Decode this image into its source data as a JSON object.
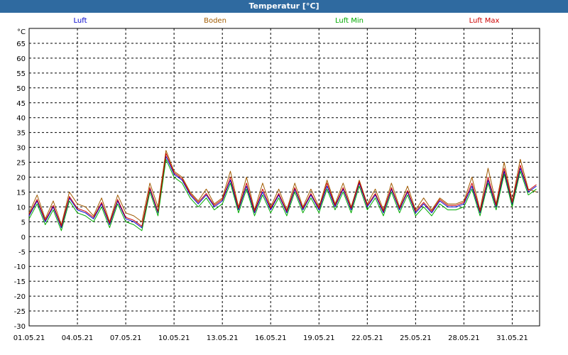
{
  "window": {
    "title": "Temperatur [°C]"
  },
  "chart_data": {
    "type": "line",
    "title": "Temperatur [°C]",
    "ylabel": "°C",
    "xlabel": "",
    "ylim": [
      -30,
      70
    ],
    "yticks": [
      65,
      60,
      55,
      50,
      45,
      40,
      35,
      30,
      25,
      20,
      15,
      10,
      5,
      0,
      -5,
      -10,
      -15,
      -20,
      -25,
      -30
    ],
    "xlim": [
      0,
      31.7
    ],
    "xticks": [
      "01.05.21",
      "04.05.21",
      "07.05.21",
      "10.05.21",
      "13.05.21",
      "16.05.21",
      "19.05.21",
      "22.05.21",
      "25.05.21",
      "28.05.21",
      "31.05.21"
    ],
    "xtick_days": [
      0,
      3,
      6,
      9,
      12,
      15,
      18,
      21,
      24,
      27,
      30
    ],
    "grid": true,
    "legend_position": "top",
    "x_unit": "days since 01.05.21",
    "x": [
      0.0,
      0.5,
      1.0,
      1.5,
      2.0,
      2.5,
      3.0,
      3.5,
      4.0,
      4.5,
      5.0,
      5.5,
      6.0,
      6.5,
      7.0,
      7.5,
      8.0,
      8.5,
      9.0,
      9.5,
      10.0,
      10.5,
      11.0,
      11.5,
      12.0,
      12.5,
      13.0,
      13.5,
      14.0,
      14.5,
      15.0,
      15.5,
      16.0,
      16.5,
      17.0,
      17.5,
      18.0,
      18.5,
      19.0,
      19.5,
      20.0,
      20.5,
      21.0,
      21.5,
      22.0,
      22.5,
      23.0,
      23.5,
      24.0,
      24.5,
      25.0,
      25.5,
      26.0,
      26.5,
      27.0,
      27.5,
      28.0,
      28.5,
      29.0,
      29.5,
      30.0,
      30.5,
      31.0,
      31.5
    ],
    "series": [
      {
        "name": "Luft",
        "color": "#0000cc",
        "values": [
          7,
          12,
          5,
          10,
          3,
          13,
          9,
          8,
          6,
          11,
          4,
          12,
          6,
          5,
          3,
          16,
          8,
          27,
          21,
          19,
          14,
          11,
          14,
          10,
          12,
          19,
          9,
          17,
          8,
          15,
          9,
          14,
          8,
          16,
          9,
          14,
          9,
          17,
          10,
          16,
          9,
          18,
          10,
          14,
          8,
          16,
          9,
          15,
          8,
          11,
          8,
          12,
          10,
          10,
          11,
          17,
          8,
          19,
          10,
          22,
          11,
          23,
          15,
          17
        ]
      },
      {
        "name": "Boden",
        "color": "#a05a00",
        "values": [
          8,
          14,
          6,
          12,
          4,
          15,
          11,
          10,
          7,
          13,
          5,
          14,
          8,
          7,
          5,
          18,
          10,
          29,
          22,
          20,
          15,
          12,
          16,
          11,
          13,
          22,
          10,
          20,
          9,
          18,
          10,
          16,
          9,
          18,
          10,
          16,
          10,
          19,
          11,
          18,
          10,
          19,
          11,
          16,
          9,
          18,
          10,
          17,
          9,
          13,
          9,
          13,
          11,
          11,
          12,
          20,
          9,
          23,
          11,
          25,
          12,
          26,
          16,
          15
        ]
      },
      {
        "name": "Luft Min",
        "color": "#00aa00",
        "values": [
          6,
          11,
          4,
          9,
          2,
          12,
          8,
          7,
          5,
          10,
          3,
          11,
          5,
          4,
          2,
          15,
          7,
          26,
          20,
          18,
          13,
          10,
          13,
          9,
          11,
          18,
          8,
          16,
          7,
          14,
          8,
          13,
          7,
          15,
          8,
          13,
          8,
          16,
          9,
          15,
          8,
          17,
          9,
          13,
          7,
          15,
          8,
          14,
          7,
          10,
          7,
          11,
          9,
          9,
          10,
          16,
          7,
          18,
          9,
          21,
          10,
          22,
          14,
          16
        ]
      },
      {
        "name": "Luft Max",
        "color": "#cc0000",
        "values": [
          7.5,
          12.5,
          5.5,
          10.5,
          3.5,
          13.5,
          9.5,
          8.5,
          6.5,
          11.5,
          4.5,
          12.5,
          6.5,
          5.5,
          3.5,
          16.5,
          8.5,
          28,
          21.5,
          19.5,
          14.5,
          11.5,
          14.5,
          10.5,
          12.5,
          20,
          9.5,
          18,
          8.5,
          16,
          9.5,
          14.5,
          8.5,
          16.5,
          9.5,
          14.5,
          9.5,
          18,
          10.5,
          16.5,
          9.5,
          18.5,
          10.5,
          14.5,
          8.5,
          16.5,
          9.5,
          15.5,
          8.5,
          11.5,
          8.5,
          12.5,
          10.5,
          10.5,
          11.5,
          18,
          8.5,
          20,
          10.5,
          23,
          11.5,
          24,
          15.5,
          17.5
        ]
      }
    ]
  }
}
